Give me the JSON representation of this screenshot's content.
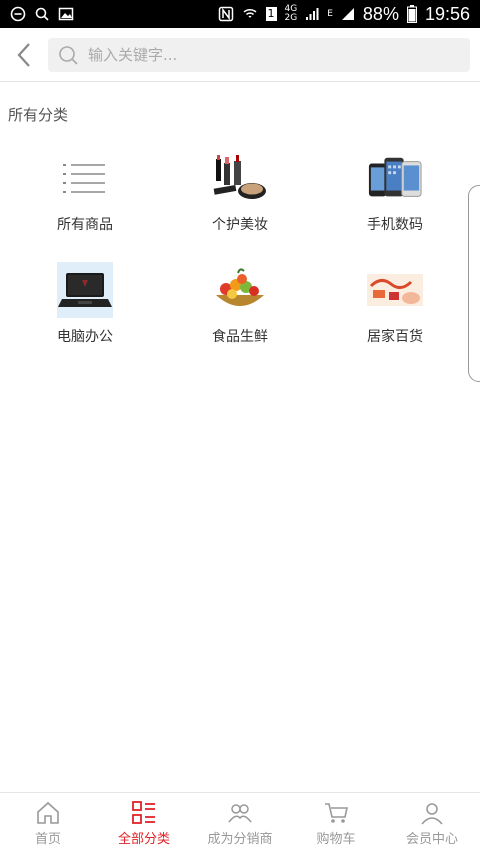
{
  "status_bar": {
    "battery": "88%",
    "time": "19:56",
    "network_4g": "4G",
    "network_2g": "2G",
    "network_e": "E",
    "sim": "1"
  },
  "search": {
    "placeholder": "输入关键字..."
  },
  "section_title": "所有分类",
  "categories": [
    {
      "label": "所有商品",
      "icon": "list-icon"
    },
    {
      "label": "个护美妆",
      "icon": "cosmetics-image"
    },
    {
      "label": "手机数码",
      "icon": "phones-image"
    },
    {
      "label": "电脑办公",
      "icon": "laptop-image"
    },
    {
      "label": "食品生鲜",
      "icon": "fruit-basket-image"
    },
    {
      "label": "居家百货",
      "icon": "household-image"
    }
  ],
  "tabs": [
    {
      "label": "首页",
      "icon": "home-icon",
      "active": false
    },
    {
      "label": "全部分类",
      "icon": "category-icon",
      "active": true
    },
    {
      "label": "成为分销商",
      "icon": "distributor-icon",
      "active": false
    },
    {
      "label": "购物车",
      "icon": "cart-icon",
      "active": false
    },
    {
      "label": "会员中心",
      "icon": "user-icon",
      "active": false
    }
  ],
  "colors": {
    "accent": "#e0242a",
    "inactive": "#999999",
    "status_bar_bg": "#000000"
  }
}
